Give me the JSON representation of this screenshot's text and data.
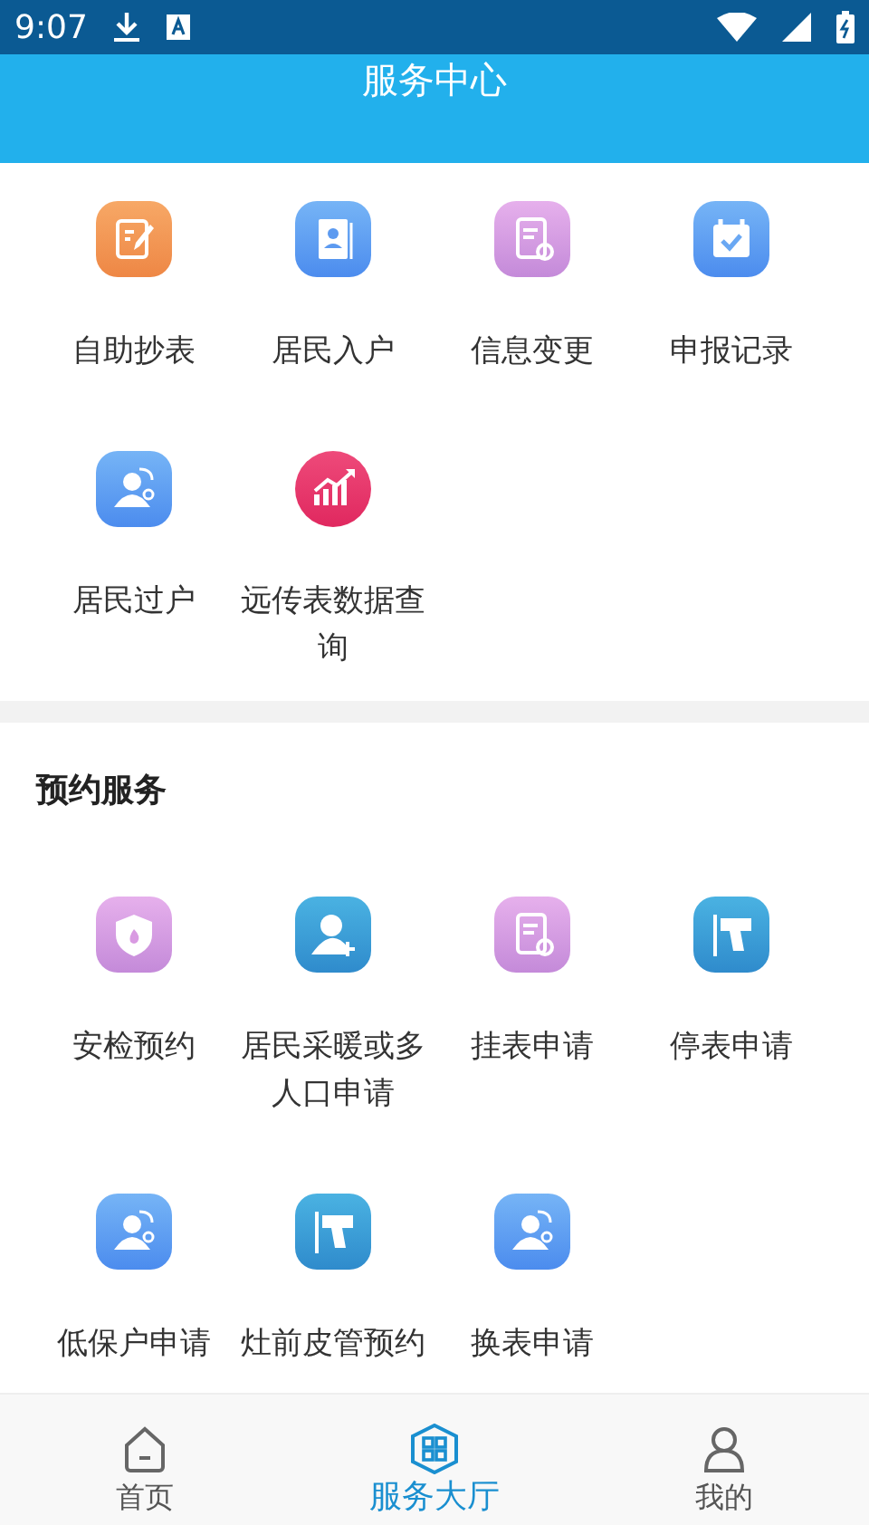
{
  "status_bar": {
    "time": "9:07"
  },
  "header": {
    "title": "服务中心"
  },
  "sections": [
    {
      "items": [
        {
          "label": "自助抄表"
        },
        {
          "label": "居民入户"
        },
        {
          "label": "信息变更"
        },
        {
          "label": "申报记录"
        },
        {
          "label": "居民过户"
        },
        {
          "label": "远传表数据查询"
        }
      ]
    },
    {
      "title": "预约服务",
      "items": [
        {
          "label": "安检预约"
        },
        {
          "label": "居民采暖或多人口申请"
        },
        {
          "label": "挂表申请"
        },
        {
          "label": "停表申请"
        },
        {
          "label": "低保户申请"
        },
        {
          "label": "灶前皮管预约"
        },
        {
          "label": "换表申请"
        }
      ]
    }
  ],
  "bottom_nav": [
    {
      "label": "首页",
      "selected": false
    },
    {
      "label": "服务大厅",
      "selected": true
    },
    {
      "label": "我的",
      "selected": false
    }
  ]
}
